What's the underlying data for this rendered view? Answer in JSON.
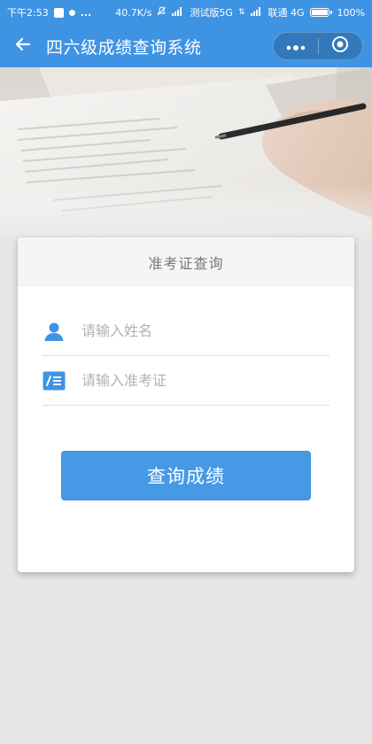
{
  "status_bar": {
    "time": "下午2:53",
    "more": "...",
    "speed": "40.7K/s",
    "carrier1": "测试版5G",
    "carrier2": "联通 4G",
    "battery": "100%"
  },
  "title_bar": {
    "title": "四六级成绩查询系统",
    "back_icon": "back-arrow-icon",
    "more_icon": "more-dots-icon",
    "close_icon": "target-icon"
  },
  "banner": {
    "image": "document-pen-photo"
  },
  "card": {
    "header": "准考证查询",
    "name_field": {
      "placeholder": "请输入姓名",
      "value": "",
      "icon": "user-icon"
    },
    "exam_field": {
      "placeholder": "请输入准考证",
      "value": "",
      "icon": "id-card-icon"
    },
    "submit_label": "查询成绩"
  },
  "colors": {
    "primary": "#3f93e3",
    "button": "#4699e4",
    "background": "#e8e6e7"
  }
}
